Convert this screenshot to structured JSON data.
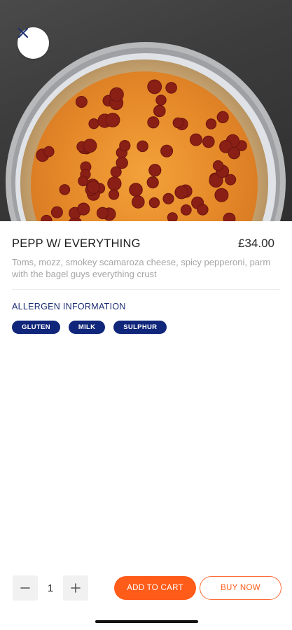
{
  "product": {
    "name": "PEPP W/ EVERYTHING",
    "price": "£34.00",
    "description": "Toms, mozz, smokey scamaroza cheese, spicy pepperoni, parm with the bagel guys everything crust",
    "image_icon": "pizza-photo"
  },
  "close_icon": "close-icon",
  "allergens": {
    "title": "ALLERGEN INFORMATION",
    "items": [
      "GLUTEN",
      "MILK",
      "SULPHUR"
    ]
  },
  "cart": {
    "quantity": "1",
    "minus_icon": "minus-icon",
    "plus_icon": "plus-icon",
    "add_to_cart_label": "ADD TO CART",
    "buy_now_label": "BUY NOW"
  },
  "colors": {
    "accent_orange": "#ff5c1a",
    "allergen_navy": "#10267a",
    "allergen_title": "#1d2e74"
  }
}
